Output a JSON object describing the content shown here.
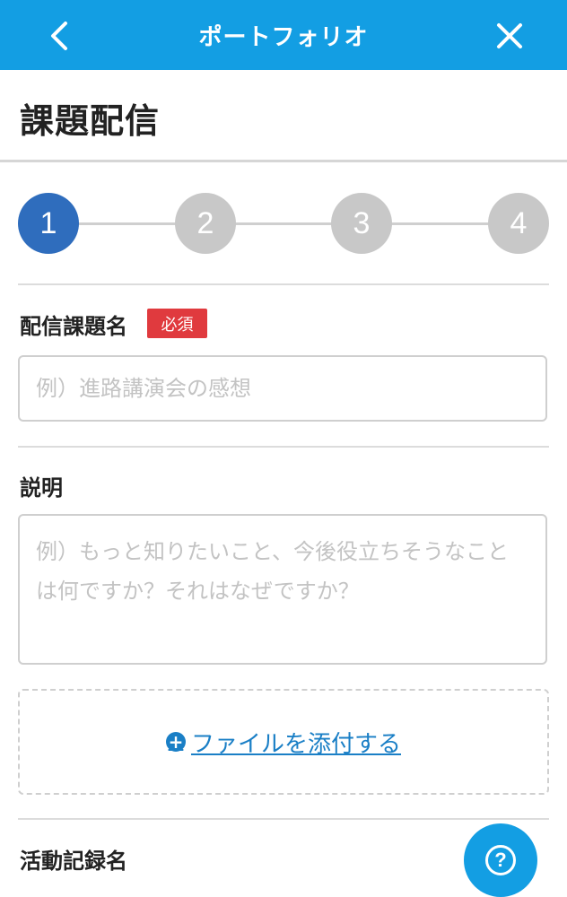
{
  "header": {
    "title": "ポートフォリオ",
    "back_icon": "chevron-left-icon",
    "close_icon": "close-icon",
    "bg_color": "#139ee3"
  },
  "page": {
    "title": "課題配信"
  },
  "stepper": {
    "steps": [
      "1",
      "2",
      "3",
      "4"
    ],
    "current": 1,
    "active_color": "#2f6dbd",
    "inactive_color": "#c8c8c8"
  },
  "form": {
    "task_name": {
      "label": "配信課題名",
      "required_badge": "必須",
      "placeholder": "例）進路講演会の感想"
    },
    "description": {
      "label": "説明",
      "placeholder": "例）もっと知りたいこと、今後役立ちそうなことは何ですか？それはなぜですか？"
    },
    "attach": {
      "label": "ファイルを添付する",
      "icon": "plus-circle-icon"
    },
    "activity_record": {
      "label": "活動記録名"
    }
  },
  "help": {
    "icon": "question-circle-icon"
  }
}
